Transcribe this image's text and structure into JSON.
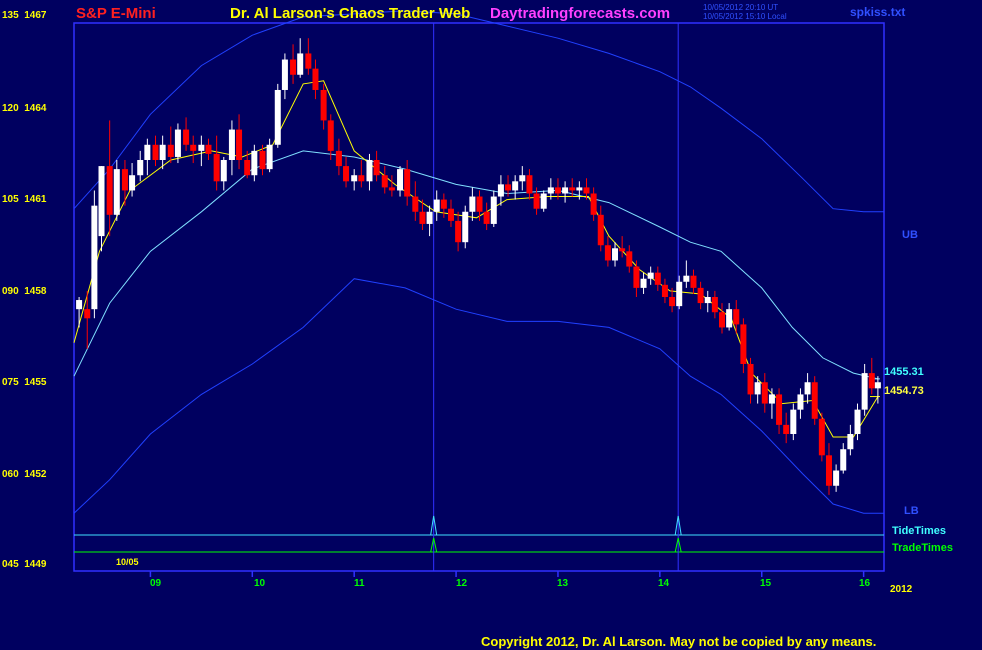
{
  "header": {
    "symbol": "S&P E-Mini",
    "title": "Dr. Al Larson's Chaos Trader Web",
    "site": "Daytradingforecasts.com",
    "timestamp_ut": "10/05/2012 20:10 UT",
    "timestamp_local": "10/05/2012 15:10 Local",
    "file": "spkiss.txt"
  },
  "footer": {
    "copyright": "Copyright 2012, Dr. Al Larson. May not be copied by any means."
  },
  "colors": {
    "background": "#000060",
    "frame": "#3030ff",
    "up_candle": "#ffffff",
    "down_candle": "#ff0000",
    "fast_ma": "#ffff00",
    "slow_ma": "#80e0ff",
    "bands": "#2040ff",
    "tide_times": "#40e0ff",
    "trade_times": "#00ff00"
  },
  "chart_data": {
    "type": "candlestick",
    "y_tick_labels": [
      {
        "left": "135",
        "right": "1467"
      },
      {
        "left": "120",
        "right": "1464"
      },
      {
        "left": "105",
        "right": "1461"
      },
      {
        "left": "090",
        "right": "1458"
      },
      {
        "left": "075",
        "right": "1455"
      },
      {
        "left": "060",
        "right": "1452"
      },
      {
        "left": "045",
        "right": "1449"
      }
    ],
    "ylim": [
      1449,
      1467
    ],
    "x_tick_labels": [
      "09",
      "10",
      "11",
      "12",
      "13",
      "14",
      "15",
      "16"
    ],
    "x_tick_hours": [
      9,
      10,
      11,
      12,
      13,
      14,
      15,
      16
    ],
    "xlim": [
      8.25,
      16.2
    ],
    "date_label": "10/05",
    "year_label": "2012",
    "series_labels": {
      "upper_band": "UB",
      "lower_band": "LB",
      "tide_times": "TideTimes",
      "trade_times": "TradeTimes"
    },
    "last_values": {
      "slow_ma": "1455.31",
      "fast_ma": "1454.73"
    },
    "last_value_numbers": {
      "slow_ma": 1455.31,
      "fast_ma": 1454.73
    },
    "marker_times": [
      11.78,
      14.18
    ],
    "candles": [
      {
        "t": 8.3,
        "o": 1457.6,
        "h": 1458.0,
        "l": 1457.0,
        "c": 1457.9
      },
      {
        "t": 8.38,
        "o": 1457.6,
        "h": 1458.2,
        "l": 1456.3,
        "c": 1457.3
      },
      {
        "t": 8.45,
        "o": 1457.6,
        "h": 1461.5,
        "l": 1457.3,
        "c": 1461.0
      },
      {
        "t": 8.52,
        "o": 1460.0,
        "h": 1462.3,
        "l": 1459.5,
        "c": 1462.3
      },
      {
        "t": 8.6,
        "o": 1462.3,
        "h": 1463.8,
        "l": 1460.0,
        "c": 1460.7
      },
      {
        "t": 8.67,
        "o": 1460.7,
        "h": 1462.5,
        "l": 1460.5,
        "c": 1462.2
      },
      {
        "t": 8.75,
        "o": 1462.2,
        "h": 1462.5,
        "l": 1461.0,
        "c": 1461.5
      },
      {
        "t": 8.82,
        "o": 1461.5,
        "h": 1462.4,
        "l": 1461.3,
        "c": 1462.0
      },
      {
        "t": 8.9,
        "o": 1462.0,
        "h": 1462.8,
        "l": 1461.8,
        "c": 1462.5
      },
      {
        "t": 8.97,
        "o": 1462.5,
        "h": 1463.2,
        "l": 1462.0,
        "c": 1463.0
      },
      {
        "t": 9.05,
        "o": 1463.0,
        "h": 1463.3,
        "l": 1462.3,
        "c": 1462.5
      },
      {
        "t": 9.12,
        "o": 1462.5,
        "h": 1463.3,
        "l": 1462.2,
        "c": 1463.0
      },
      {
        "t": 9.2,
        "o": 1463.0,
        "h": 1463.6,
        "l": 1462.4,
        "c": 1462.6
      },
      {
        "t": 9.27,
        "o": 1462.6,
        "h": 1463.7,
        "l": 1462.4,
        "c": 1463.5
      },
      {
        "t": 9.35,
        "o": 1463.5,
        "h": 1463.9,
        "l": 1462.8,
        "c": 1463.0
      },
      {
        "t": 9.42,
        "o": 1463.0,
        "h": 1463.3,
        "l": 1462.4,
        "c": 1462.8
      },
      {
        "t": 9.5,
        "o": 1462.8,
        "h": 1463.3,
        "l": 1462.3,
        "c": 1463.0
      },
      {
        "t": 9.57,
        "o": 1463.0,
        "h": 1463.2,
        "l": 1462.5,
        "c": 1462.7
      },
      {
        "t": 9.65,
        "o": 1462.7,
        "h": 1463.3,
        "l": 1461.5,
        "c": 1461.8
      },
      {
        "t": 9.72,
        "o": 1461.8,
        "h": 1462.6,
        "l": 1461.5,
        "c": 1462.5
      },
      {
        "t": 9.8,
        "o": 1462.5,
        "h": 1463.8,
        "l": 1462.0,
        "c": 1463.5
      },
      {
        "t": 9.87,
        "o": 1463.5,
        "h": 1464.0,
        "l": 1462.2,
        "c": 1462.5
      },
      {
        "t": 9.95,
        "o": 1462.5,
        "h": 1462.8,
        "l": 1461.9,
        "c": 1462.0
      },
      {
        "t": 10.02,
        "o": 1462.0,
        "h": 1463.0,
        "l": 1461.8,
        "c": 1462.8
      },
      {
        "t": 10.1,
        "o": 1462.8,
        "h": 1463.0,
        "l": 1462.0,
        "c": 1462.2
      },
      {
        "t": 10.17,
        "o": 1462.2,
        "h": 1463.2,
        "l": 1462.1,
        "c": 1463.0
      },
      {
        "t": 10.25,
        "o": 1463.0,
        "h": 1465.0,
        "l": 1462.9,
        "c": 1464.8
      },
      {
        "t": 10.32,
        "o": 1464.8,
        "h": 1466.0,
        "l": 1464.5,
        "c": 1465.8
      },
      {
        "t": 10.4,
        "o": 1465.8,
        "h": 1466.3,
        "l": 1465.0,
        "c": 1465.3
      },
      {
        "t": 10.47,
        "o": 1465.3,
        "h": 1466.5,
        "l": 1465.2,
        "c": 1466.0
      },
      {
        "t": 10.55,
        "o": 1466.0,
        "h": 1466.5,
        "l": 1465.3,
        "c": 1465.5
      },
      {
        "t": 10.62,
        "o": 1465.5,
        "h": 1465.8,
        "l": 1464.5,
        "c": 1464.8
      },
      {
        "t": 10.7,
        "o": 1464.8,
        "h": 1465.0,
        "l": 1463.5,
        "c": 1463.8
      },
      {
        "t": 10.77,
        "o": 1463.8,
        "h": 1464.0,
        "l": 1462.5,
        "c": 1462.8
      },
      {
        "t": 10.85,
        "o": 1462.8,
        "h": 1463.2,
        "l": 1462.0,
        "c": 1462.3
      },
      {
        "t": 10.92,
        "o": 1462.3,
        "h": 1462.6,
        "l": 1461.6,
        "c": 1461.8
      },
      {
        "t": 11.0,
        "o": 1461.8,
        "h": 1462.2,
        "l": 1461.5,
        "c": 1462.0
      },
      {
        "t": 11.07,
        "o": 1462.0,
        "h": 1462.5,
        "l": 1461.6,
        "c": 1461.8
      },
      {
        "t": 11.15,
        "o": 1461.8,
        "h": 1462.7,
        "l": 1461.5,
        "c": 1462.5
      },
      {
        "t": 11.22,
        "o": 1462.5,
        "h": 1462.8,
        "l": 1461.8,
        "c": 1462.0
      },
      {
        "t": 11.3,
        "o": 1462.0,
        "h": 1462.3,
        "l": 1461.4,
        "c": 1461.6
      },
      {
        "t": 11.37,
        "o": 1461.6,
        "h": 1462.0,
        "l": 1461.3,
        "c": 1461.5
      },
      {
        "t": 11.45,
        "o": 1461.5,
        "h": 1462.3,
        "l": 1461.3,
        "c": 1462.2
      },
      {
        "t": 11.52,
        "o": 1462.2,
        "h": 1462.5,
        "l": 1461.0,
        "c": 1461.3
      },
      {
        "t": 11.6,
        "o": 1461.3,
        "h": 1461.8,
        "l": 1460.5,
        "c": 1460.8
      },
      {
        "t": 11.67,
        "o": 1460.8,
        "h": 1461.2,
        "l": 1460.2,
        "c": 1460.4
      },
      {
        "t": 11.74,
        "o": 1460.4,
        "h": 1461.0,
        "l": 1460.0,
        "c": 1460.8
      },
      {
        "t": 11.81,
        "o": 1460.8,
        "h": 1461.5,
        "l": 1460.5,
        "c": 1461.2
      },
      {
        "t": 11.88,
        "o": 1461.2,
        "h": 1461.4,
        "l": 1460.6,
        "c": 1460.9
      },
      {
        "t": 11.95,
        "o": 1460.9,
        "h": 1461.2,
        "l": 1460.3,
        "c": 1460.5
      },
      {
        "t": 12.02,
        "o": 1460.5,
        "h": 1460.8,
        "l": 1459.5,
        "c": 1459.8
      },
      {
        "t": 12.09,
        "o": 1459.8,
        "h": 1461.0,
        "l": 1459.6,
        "c": 1460.8
      },
      {
        "t": 12.16,
        "o": 1460.8,
        "h": 1461.6,
        "l": 1460.5,
        "c": 1461.3
      },
      {
        "t": 12.23,
        "o": 1461.3,
        "h": 1461.5,
        "l": 1460.5,
        "c": 1460.8
      },
      {
        "t": 12.3,
        "o": 1460.8,
        "h": 1461.1,
        "l": 1460.2,
        "c": 1460.4
      },
      {
        "t": 12.37,
        "o": 1460.4,
        "h": 1461.5,
        "l": 1460.3,
        "c": 1461.3
      },
      {
        "t": 12.44,
        "o": 1461.3,
        "h": 1462.0,
        "l": 1461.0,
        "c": 1461.7
      },
      {
        "t": 12.51,
        "o": 1461.7,
        "h": 1462.0,
        "l": 1461.3,
        "c": 1461.5
      },
      {
        "t": 12.58,
        "o": 1461.5,
        "h": 1462.0,
        "l": 1461.2,
        "c": 1461.8
      },
      {
        "t": 12.65,
        "o": 1461.8,
        "h": 1462.3,
        "l": 1461.5,
        "c": 1462.0
      },
      {
        "t": 12.72,
        "o": 1462.0,
        "h": 1462.2,
        "l": 1461.2,
        "c": 1461.4
      },
      {
        "t": 12.79,
        "o": 1461.4,
        "h": 1461.6,
        "l": 1460.7,
        "c": 1460.9
      },
      {
        "t": 12.86,
        "o": 1460.9,
        "h": 1461.5,
        "l": 1460.8,
        "c": 1461.4
      },
      {
        "t": 12.93,
        "o": 1461.4,
        "h": 1461.9,
        "l": 1461.2,
        "c": 1461.6
      },
      {
        "t": 13.0,
        "o": 1461.6,
        "h": 1461.9,
        "l": 1461.2,
        "c": 1461.4
      },
      {
        "t": 13.07,
        "o": 1461.4,
        "h": 1461.8,
        "l": 1461.1,
        "c": 1461.6
      },
      {
        "t": 13.14,
        "o": 1461.6,
        "h": 1461.9,
        "l": 1461.3,
        "c": 1461.5
      },
      {
        "t": 13.21,
        "o": 1461.5,
        "h": 1461.8,
        "l": 1461.2,
        "c": 1461.6
      },
      {
        "t": 13.28,
        "o": 1461.6,
        "h": 1461.9,
        "l": 1461.2,
        "c": 1461.4
      },
      {
        "t": 13.35,
        "o": 1461.4,
        "h": 1461.6,
        "l": 1460.5,
        "c": 1460.7
      },
      {
        "t": 13.42,
        "o": 1460.7,
        "h": 1461.0,
        "l": 1459.5,
        "c": 1459.7
      },
      {
        "t": 13.49,
        "o": 1459.7,
        "h": 1460.0,
        "l": 1459.0,
        "c": 1459.2
      },
      {
        "t": 13.56,
        "o": 1459.2,
        "h": 1459.8,
        "l": 1459.0,
        "c": 1459.6
      },
      {
        "t": 13.63,
        "o": 1459.6,
        "h": 1460.0,
        "l": 1459.3,
        "c": 1459.5
      },
      {
        "t": 13.7,
        "o": 1459.5,
        "h": 1459.7,
        "l": 1458.8,
        "c": 1459.0
      },
      {
        "t": 13.77,
        "o": 1459.0,
        "h": 1459.2,
        "l": 1458.0,
        "c": 1458.3
      },
      {
        "t": 13.84,
        "o": 1458.3,
        "h": 1458.8,
        "l": 1458.1,
        "c": 1458.6
      },
      {
        "t": 13.91,
        "o": 1458.6,
        "h": 1459.0,
        "l": 1458.4,
        "c": 1458.8
      },
      {
        "t": 13.98,
        "o": 1458.8,
        "h": 1459.0,
        "l": 1458.2,
        "c": 1458.4
      },
      {
        "t": 14.05,
        "o": 1458.4,
        "h": 1458.6,
        "l": 1457.8,
        "c": 1458.0
      },
      {
        "t": 14.12,
        "o": 1458.0,
        "h": 1458.3,
        "l": 1457.5,
        "c": 1457.7
      },
      {
        "t": 14.19,
        "o": 1457.7,
        "h": 1458.7,
        "l": 1457.6,
        "c": 1458.5
      },
      {
        "t": 14.26,
        "o": 1458.5,
        "h": 1459.2,
        "l": 1458.3,
        "c": 1458.7
      },
      {
        "t": 14.33,
        "o": 1458.7,
        "h": 1458.9,
        "l": 1458.1,
        "c": 1458.3
      },
      {
        "t": 14.4,
        "o": 1458.3,
        "h": 1458.5,
        "l": 1457.6,
        "c": 1457.8
      },
      {
        "t": 14.47,
        "o": 1457.8,
        "h": 1458.2,
        "l": 1457.5,
        "c": 1458.0
      },
      {
        "t": 14.54,
        "o": 1458.0,
        "h": 1458.2,
        "l": 1457.3,
        "c": 1457.5
      },
      {
        "t": 14.61,
        "o": 1457.5,
        "h": 1457.8,
        "l": 1456.8,
        "c": 1457.0
      },
      {
        "t": 14.68,
        "o": 1457.0,
        "h": 1457.8,
        "l": 1456.9,
        "c": 1457.6
      },
      {
        "t": 14.75,
        "o": 1457.6,
        "h": 1457.9,
        "l": 1456.8,
        "c": 1457.1
      },
      {
        "t": 14.82,
        "o": 1457.1,
        "h": 1457.3,
        "l": 1455.5,
        "c": 1455.8
      },
      {
        "t": 14.89,
        "o": 1455.8,
        "h": 1456.0,
        "l": 1454.5,
        "c": 1454.8
      },
      {
        "t": 14.96,
        "o": 1454.8,
        "h": 1455.4,
        "l": 1454.5,
        "c": 1455.2
      },
      {
        "t": 15.03,
        "o": 1455.2,
        "h": 1455.5,
        "l": 1454.2,
        "c": 1454.5
      },
      {
        "t": 15.1,
        "o": 1454.5,
        "h": 1455.0,
        "l": 1454.0,
        "c": 1454.8
      },
      {
        "t": 15.17,
        "o": 1454.8,
        "h": 1455.0,
        "l": 1453.5,
        "c": 1453.8
      },
      {
        "t": 15.24,
        "o": 1453.8,
        "h": 1454.2,
        "l": 1453.2,
        "c": 1453.5
      },
      {
        "t": 15.31,
        "o": 1453.5,
        "h": 1454.5,
        "l": 1453.3,
        "c": 1454.3
      },
      {
        "t": 15.38,
        "o": 1454.3,
        "h": 1455.0,
        "l": 1454.0,
        "c": 1454.8
      },
      {
        "t": 15.45,
        "o": 1454.8,
        "h": 1455.5,
        "l": 1454.5,
        "c": 1455.2
      },
      {
        "t": 15.52,
        "o": 1455.2,
        "h": 1455.4,
        "l": 1453.8,
        "c": 1454.0
      },
      {
        "t": 15.59,
        "o": 1454.0,
        "h": 1454.2,
        "l": 1452.6,
        "c": 1452.8
      },
      {
        "t": 15.66,
        "o": 1452.8,
        "h": 1453.2,
        "l": 1451.5,
        "c": 1451.8
      },
      {
        "t": 15.73,
        "o": 1451.8,
        "h": 1452.5,
        "l": 1451.6,
        "c": 1452.3
      },
      {
        "t": 15.8,
        "o": 1452.3,
        "h": 1453.2,
        "l": 1452.2,
        "c": 1453.0
      },
      {
        "t": 15.87,
        "o": 1453.0,
        "h": 1453.8,
        "l": 1452.8,
        "c": 1453.5
      },
      {
        "t": 15.94,
        "o": 1453.5,
        "h": 1454.5,
        "l": 1453.3,
        "c": 1454.3
      },
      {
        "t": 16.01,
        "o": 1454.3,
        "h": 1455.8,
        "l": 1454.1,
        "c": 1455.5
      },
      {
        "t": 16.08,
        "o": 1455.5,
        "h": 1456.0,
        "l": 1454.8,
        "c": 1455.0
      },
      {
        "t": 16.14,
        "o": 1455.0,
        "h": 1455.4,
        "l": 1454.5,
        "c": 1455.2
      }
    ],
    "lines": {
      "upper_band": [
        [
          8.25,
          1460.9
        ],
        [
          8.6,
          1462.2
        ],
        [
          9.0,
          1464.0
        ],
        [
          9.5,
          1465.6
        ],
        [
          10.0,
          1466.6
        ],
        [
          10.5,
          1467.2
        ],
        [
          11.0,
          1467.3
        ],
        [
          11.5,
          1467.4
        ],
        [
          12.0,
          1467.3
        ],
        [
          12.5,
          1466.9
        ],
        [
          13.0,
          1466.5
        ],
        [
          13.5,
          1466.0
        ],
        [
          14.0,
          1465.4
        ],
        [
          14.3,
          1464.9
        ],
        [
          14.6,
          1464.2
        ],
        [
          15.0,
          1463.2
        ],
        [
          15.4,
          1461.9
        ],
        [
          15.7,
          1460.9
        ],
        [
          16.0,
          1460.8
        ],
        [
          16.2,
          1460.8
        ]
      ],
      "lower_band": [
        [
          8.25,
          1450.9
        ],
        [
          8.6,
          1452.0
        ],
        [
          9.0,
          1453.5
        ],
        [
          9.5,
          1454.8
        ],
        [
          10.0,
          1455.8
        ],
        [
          10.5,
          1457.0
        ],
        [
          11.0,
          1458.6
        ],
        [
          11.5,
          1458.3
        ],
        [
          12.0,
          1457.6
        ],
        [
          12.5,
          1457.2
        ],
        [
          13.0,
          1457.2
        ],
        [
          13.5,
          1457.0
        ],
        [
          14.0,
          1456.3
        ],
        [
          14.3,
          1455.4
        ],
        [
          14.6,
          1454.8
        ],
        [
          15.0,
          1453.6
        ],
        [
          15.4,
          1452.2
        ],
        [
          15.7,
          1451.2
        ],
        [
          16.0,
          1450.9
        ],
        [
          16.2,
          1450.9
        ]
      ],
      "slow_ma": [
        [
          8.25,
          1455.4
        ],
        [
          8.6,
          1457.8
        ],
        [
          9.0,
          1459.5
        ],
        [
          9.5,
          1460.8
        ],
        [
          10.0,
          1462.2
        ],
        [
          10.5,
          1462.8
        ],
        [
          11.0,
          1462.6
        ],
        [
          11.5,
          1462.2
        ],
        [
          12.0,
          1461.7
        ],
        [
          12.5,
          1461.4
        ],
        [
          13.0,
          1461.5
        ],
        [
          13.5,
          1461.1
        ],
        [
          14.0,
          1460.3
        ],
        [
          14.3,
          1459.8
        ],
        [
          14.6,
          1459.5
        ],
        [
          15.0,
          1458.3
        ],
        [
          15.3,
          1457.0
        ],
        [
          15.6,
          1456.0
        ],
        [
          15.9,
          1455.5
        ],
        [
          16.14,
          1455.31
        ]
      ],
      "fast_ma": [
        [
          8.25,
          1456.5
        ],
        [
          8.5,
          1459.5
        ],
        [
          8.8,
          1461.5
        ],
        [
          9.2,
          1462.5
        ],
        [
          9.6,
          1462.8
        ],
        [
          9.9,
          1462.6
        ],
        [
          10.2,
          1463.0
        ],
        [
          10.5,
          1465.0
        ],
        [
          10.7,
          1465.1
        ],
        [
          11.0,
          1462.8
        ],
        [
          11.4,
          1461.7
        ],
        [
          11.8,
          1460.8
        ],
        [
          12.2,
          1460.6
        ],
        [
          12.5,
          1461.2
        ],
        [
          12.9,
          1461.3
        ],
        [
          13.3,
          1461.3
        ],
        [
          13.5,
          1460.0
        ],
        [
          13.8,
          1458.9
        ],
        [
          14.1,
          1458.2
        ],
        [
          14.4,
          1458.1
        ],
        [
          14.7,
          1457.3
        ],
        [
          14.9,
          1455.5
        ],
        [
          15.2,
          1454.5
        ],
        [
          15.5,
          1454.6
        ],
        [
          15.7,
          1453.4
        ],
        [
          15.9,
          1453.4
        ],
        [
          16.14,
          1454.73
        ]
      ]
    }
  }
}
